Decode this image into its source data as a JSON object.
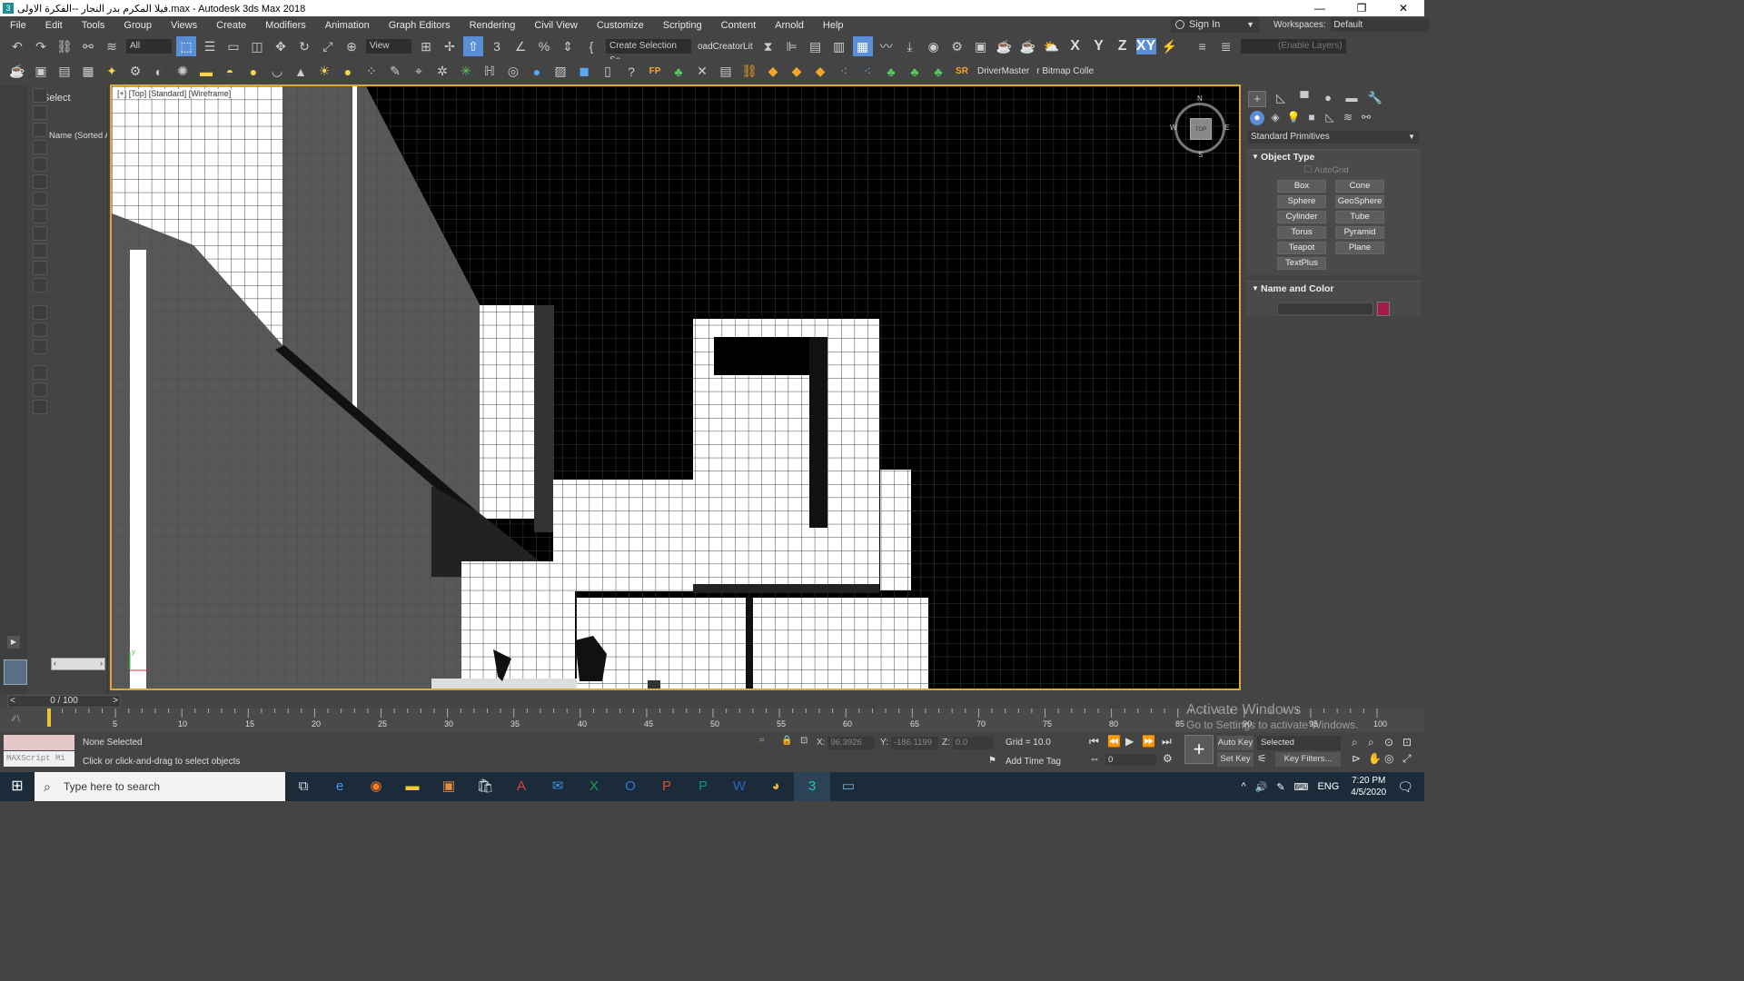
{
  "window": {
    "title": "فيلا المكرم بدر النجار --الفكرة الاولى.max - Autodesk 3ds Max 2018",
    "minimize": "—",
    "restore": "❐",
    "close": "✕"
  },
  "menu": [
    "File",
    "Edit",
    "Tools",
    "Group",
    "Views",
    "Create",
    "Modifiers",
    "Animation",
    "Graph Editors",
    "Rendering",
    "Civil View",
    "Customize",
    "Scripting",
    "Content",
    "Arnold",
    "Help"
  ],
  "signin": {
    "label": "Sign In"
  },
  "workspaces": {
    "label": "Workspaces:",
    "value": "Default"
  },
  "toolbar": {
    "filter_all": "All",
    "ref_coord": "View",
    "selection_set": "Create Selection Se",
    "road_creator": "oadCreatorLit",
    "enable_layers": "(Enable Layers)",
    "axis_x": "X",
    "axis_y": "Y",
    "axis_z": "Z",
    "axis_xy": "XY",
    "drivermaster": "DriverMaster",
    "bitmap": "r Bitmap Colle",
    "fp": "FP",
    "sr": "SR"
  },
  "scene_explorer": {
    "title": "Select",
    "column": "Name (Sorted A"
  },
  "viewport": {
    "label": "[+] [Top] [Standard] [Wireframe]",
    "viewcube_top": "TOP",
    "dir_n": "N",
    "dir_s": "S",
    "dir_e": "E",
    "dir_w": "W",
    "axis_y_label": "y"
  },
  "command_panel": {
    "category": "Standard Primitives",
    "object_type_title": "Object Type",
    "autogrid": "AutoGrid",
    "buttons": [
      "Box",
      "Cone",
      "Sphere",
      "GeoSphere",
      "Cylinder",
      "Tube",
      "Torus",
      "Pyramid",
      "Teapot",
      "Plane",
      "TextPlus"
    ],
    "name_color_title": "Name and Color",
    "color": "#a41a4a"
  },
  "timeline": {
    "slider": "0 / 100",
    "ticks": [
      "5",
      "10",
      "15",
      "20",
      "25",
      "30",
      "35",
      "40",
      "45",
      "50",
      "55",
      "60",
      "65",
      "70",
      "75",
      "80",
      "85",
      "90",
      "95",
      "100"
    ]
  },
  "status": {
    "maxscript": "MAXScript Mi",
    "selected": "None Selected",
    "prompt": "Click or click-and-drag to select objects",
    "x_label": "X:",
    "x_value": "96.3926",
    "y_label": "Y:",
    "y_value": "-186.1199",
    "z_label": "Z:",
    "z_value": "0.0",
    "grid": "Grid = 10.0",
    "add_time_tag": "Add Time Tag",
    "auto_key": "Auto Key",
    "set_key": "Set Key",
    "selected_dd": "Selected",
    "key_filters": "Key Filters...",
    "frame": "0"
  },
  "watermark": {
    "line1": "Activate Windows",
    "line2": "Go to Settings to activate Windows."
  },
  "taskbar": {
    "search": "Type here to search",
    "lang": "ENG",
    "time": "7:20 PM",
    "date": "4/5/2020"
  }
}
